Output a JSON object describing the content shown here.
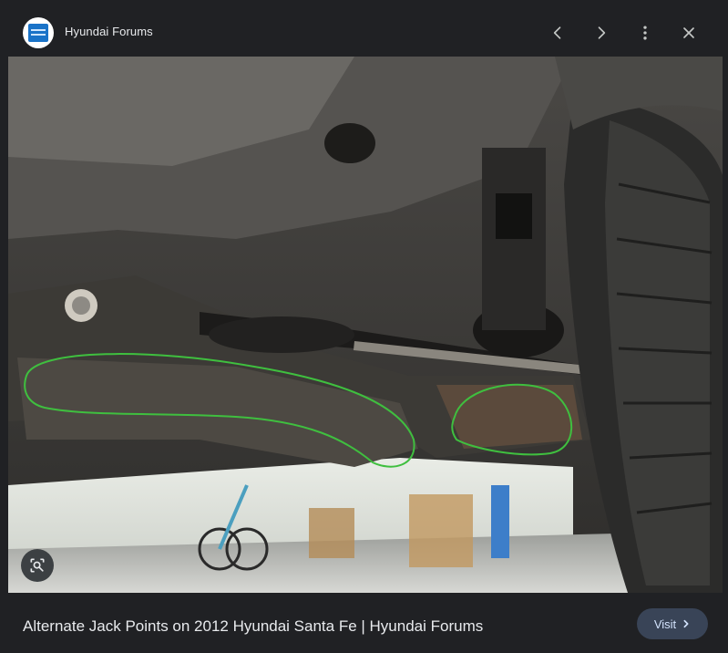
{
  "header": {
    "source_name": "Hyundai Forums",
    "logo_icon": "hyundai-forums-logo",
    "prev_icon": "chevron-left-icon",
    "next_icon": "chevron-right-icon",
    "more_icon": "more-vert-icon",
    "close_icon": "close-icon"
  },
  "image": {
    "subject": "underside-of-vehicle"
  },
  "lens": {
    "icon": "lens-search-icon"
  },
  "footer": {
    "caption": "Alternate Jack Points on 2012 Hyundai Santa Fe | Hyundai Forums",
    "visit_label": "Visit",
    "visit_icon": "chevron-right-icon"
  },
  "colors": {
    "panel_bg": "#202124",
    "visit_bg": "#394457",
    "visit_text": "#d3e3fd",
    "annotation_green": "#3fbf3f"
  }
}
